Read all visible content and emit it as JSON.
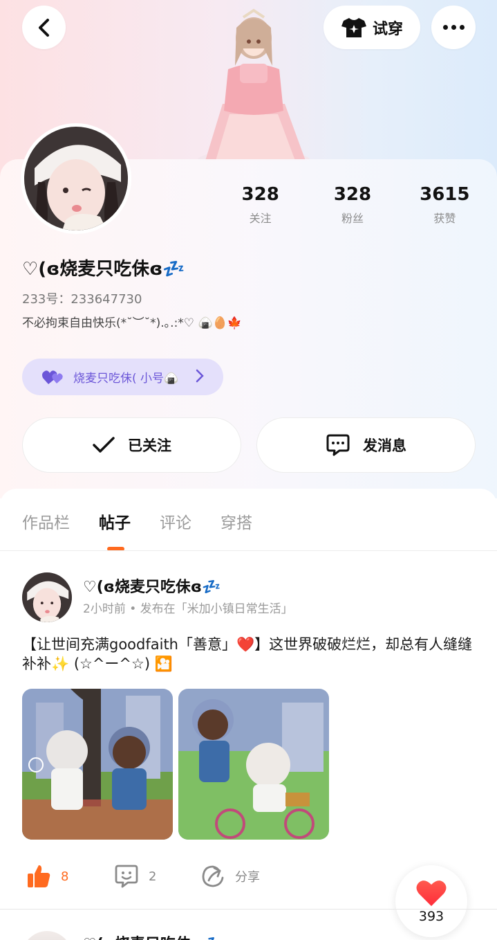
{
  "header": {
    "try_on_label": "试穿"
  },
  "profile": {
    "nickname": "♡(ɞ烧麦只吃佅ɞ💤",
    "uid_text": "233号：233647730",
    "bio": "不必拘束自由快乐(*˘︶˘*).｡.:*♡ 🍙🥚🍁",
    "stats": [
      {
        "value": "328",
        "label": "关注"
      },
      {
        "value": "328",
        "label": "粉丝"
      },
      {
        "value": "3615",
        "label": "获赞"
      }
    ],
    "alt_account_label": "烧麦只吃佅( 小号🍙",
    "follow_label": "已关注",
    "message_label": "发消息"
  },
  "tabs": [
    {
      "label": "作品栏",
      "active": false
    },
    {
      "label": "帖子",
      "active": true
    },
    {
      "label": "评论",
      "active": false
    },
    {
      "label": "穿搭",
      "active": false
    }
  ],
  "post": {
    "author": "♡(ɞ烧麦只吃佅ɞ💤",
    "meta": "2小时前 • 发布在「米加小镇日常生活」",
    "text": "【让世间充满goodfaith「善意」❤️】这世界破破烂烂，却总有人缝缝补补✨ (☆^ー^☆) 🎦",
    "likes": "8",
    "comments": "2",
    "share_label": "分享"
  },
  "floating_like": {
    "count": "393"
  },
  "next_post": {
    "author": "♡(ɞ烧麦只吃佅ɞ💤"
  },
  "colors": {
    "accent": "#ff6a1f",
    "purple": "#6b56d8",
    "heart": "#ff3b3b"
  }
}
